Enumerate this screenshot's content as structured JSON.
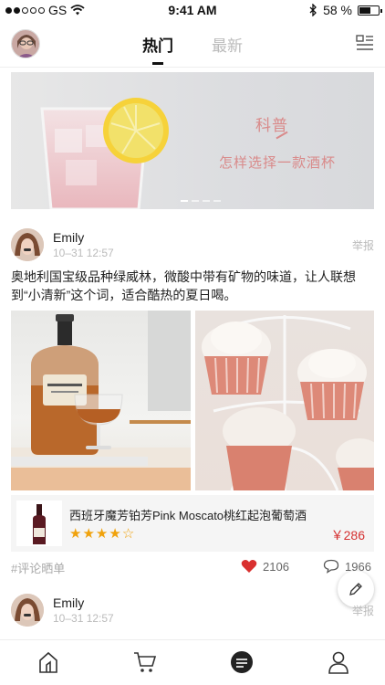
{
  "status_bar": {
    "carrier": "GS",
    "time": "9:41 AM",
    "battery": "58 %",
    "battery_level": 0.58
  },
  "nav": {
    "tabs": [
      {
        "label": "热门",
        "active": true
      },
      {
        "label": "最新",
        "active": false
      }
    ],
    "icons": [
      "avatar",
      "menu-icon"
    ]
  },
  "banner": {
    "title": "科普",
    "subtitle": "怎样选择一款酒杯",
    "pages": 4,
    "current_page": 1
  },
  "posts": [
    {
      "author": "Emily",
      "time": "10–31 12:57",
      "report_label": "举报",
      "text": "奥地利国宝级品种绿威林，微酸中带有矿物的味道，让人联想到“小清新”这个词，适合酷热的夏日喝。",
      "product": {
        "name": "西班牙魔芳铂芳Pink Moscato桃红起泡葡萄酒",
        "rating": 4,
        "rating_max": 5,
        "price": "￥286"
      },
      "tag": "#评论晒单",
      "likes": "2106",
      "comments": "1966"
    },
    {
      "author": "Emily",
      "time": "10–31 12:57",
      "report_label": "举报"
    }
  ],
  "tabbar": {
    "items": [
      "home-icon",
      "cart-icon",
      "feed-icon",
      "user-icon"
    ],
    "active": "feed-icon"
  },
  "colors": {
    "accent_red": "#d53131",
    "star": "#f0a20c",
    "banner_text": "#d98a8a"
  }
}
